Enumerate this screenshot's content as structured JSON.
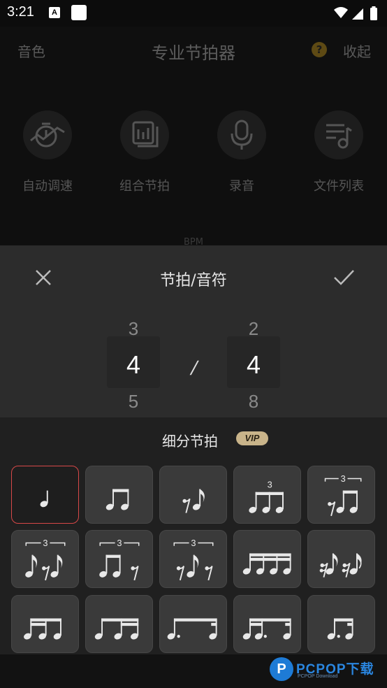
{
  "status_bar": {
    "time": "3:21",
    "a_badge": "A"
  },
  "app": {
    "left_label": "音色",
    "title": "专业节拍器",
    "help_icon_label": "?",
    "right_label": "收起",
    "features": [
      {
        "label": "自动调速",
        "icon": "timer-speed-icon"
      },
      {
        "label": "组合节拍",
        "icon": "combo-beat-icon"
      },
      {
        "label": "录音",
        "icon": "microphone-icon"
      },
      {
        "label": "文件列表",
        "icon": "music-list-icon"
      }
    ],
    "bpm_label": "BPM"
  },
  "sheet": {
    "title": "节拍/音符",
    "beats_picker": {
      "prev": "3",
      "current": "4",
      "next": "5"
    },
    "separator": "/",
    "note_picker": {
      "prev": "2",
      "current": "4",
      "next": "8"
    },
    "subdivision_title": "细分节拍",
    "vip_badge": "VIP",
    "selected_pattern_index": 0,
    "patterns": [
      "quarter-note-icon",
      "two-eighths-icon",
      "eighth-rest-eighth-icon",
      "three-sixteenths-triplet-icon",
      "rest-two-eighths-triplet-icon",
      "eighth-rest-eighth-triplet-icon",
      "two-eighths-rest-triplet-icon",
      "rest-eighth-rest-triplet-icon",
      "four-sixteenths-icon",
      "sixteenth-rests-pattern-icon",
      "eighth-two-sixteenths-icon",
      "two-sixteenths-eighth-icon",
      "dotted-eighth-sixteenth-icon",
      "sixteenth-dotted-eighth-icon",
      "dotted-eighth-sixteenth-alt-icon"
    ]
  },
  "watermark": {
    "logo": "P",
    "name": "PCPOP下载",
    "sub": "PCPOP Download"
  },
  "colors": {
    "accent_selected": "#d84848",
    "vip_gold": "#c9b48a",
    "watermark_blue": "#2a86e0"
  }
}
